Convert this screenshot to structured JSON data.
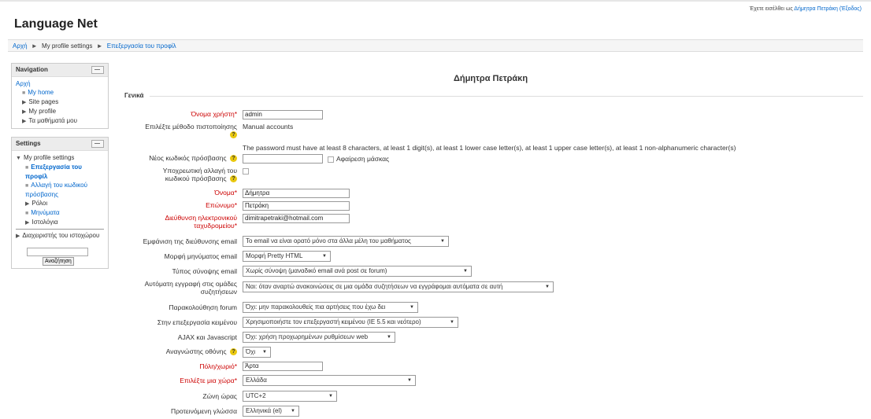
{
  "header": {
    "site_name": "Language Net",
    "login_prefix": "Έχετε εισέλθει ως",
    "login_user": "Δήμητρα Πετράκη",
    "logout": "(Έξοδος)"
  },
  "breadcrumb": {
    "home": "Αρχή",
    "sep": "►",
    "settings": "My profile settings",
    "current": "Επεξεργασία του προφίλ"
  },
  "navigation": {
    "title": "Navigation",
    "home": "Αρχή",
    "items": [
      "My home",
      "Site pages",
      "My profile",
      "Τα μαθήματά μου"
    ]
  },
  "settings": {
    "title": "Settings",
    "profile_settings": "My profile settings",
    "edit_profile": "Επεξεργασία του προφίλ",
    "change_password": "Αλλαγή του κωδικού πρόσβασης",
    "roles": "Ρόλοι",
    "messages": "Μηνύματα",
    "blogs": "Ιστολόγια",
    "site_admin": "Διαχειριστής του ιστοχώρου",
    "search_button": "Αναζήτηση"
  },
  "form": {
    "page_title": "Δήμητρα Πετράκη",
    "legend": "Γενικά",
    "username_label": "Όνομα χρήστη",
    "username": "admin",
    "auth_label": "Επιλέξτε μέθοδο πιστοποίησης",
    "auth_value": "Manual accounts",
    "password_rules": "The password must have at least 8 characters, at least 1 digit(s), at least 1 lower case letter(s), at least 1 upper case letter(s), at least 1 non-alphanumeric character(s)",
    "new_password_label": "Νέος κωδικός πρόσβασης",
    "unmask_label": "Αφαίρεση μάσκας",
    "force_change_label_1": "Υποχρεωτική αλλαγή του",
    "force_change_label_2": "κωδικού πρόσβασης",
    "firstname_label": "Όνομα",
    "firstname": "Δήμητρα",
    "lastname_label": "Επώνυμο",
    "lastname": "Πετράκη",
    "email_label_1": "Διεύθυνση ηλεκτρονικού",
    "email_label_2": "ταχυδρομείου",
    "email": "dimitrapetraki@hotmail.com",
    "emaildisplay_label": "Εμφάνιση της διεύθυνσης email",
    "emaildisplay": "Το email να είναι ορατό μόνο στα άλλα μέλη του μαθήματος",
    "mailformat_label": "Μορφή μηνύματος email",
    "mailformat": "Μορφή Pretty HTML",
    "maildigest_label": "Τύπος σύνοψης email",
    "maildigest": "Χωρίς σύνοψη (μαναδικό email ανά post σε forum)",
    "autosub_label_1": "Αυτόματη εγγραφή στις ομάδες",
    "autosub_label_2": "συζητήσεων",
    "autosub": "Ναι: όταν αναρτώ ανακοινώσεις σε μια ομάδα συζητήσεων να εγγράφομαι αυτόματα σε αυτή",
    "tracking_label": "Παρακολούθηση forum",
    "tracking": "Όχι: μην παρακολουθείς πια αρτήσεις που έχω δει",
    "editor_label": "Στην επεξεργασία κειμένου",
    "editor": "Χρησιμοποιήστε τον επεξεργαστή κειμένου (IE 5.5 και νεότερο)",
    "ajax_label": "AJAX και Javascript",
    "ajax": "Όχι: χρήση προχωρημένων ρυθμίσεων web",
    "screenreader_label": "Αναγνώστης οθόνης",
    "screenreader": "Όχι",
    "city_label": "Πόλη/χωριό",
    "city": "Άρτα",
    "country_label": "Επιλέξτε μια χώρα",
    "country": "Ελλάδα",
    "timezone_label": "Ζώνη ώρας",
    "timezone": "UTC+2",
    "lang_label": "Προτεινόμενη γλώσσα",
    "lang": "Ελληνικά (el)",
    "required_mark": "*",
    "help_mark": "?",
    "dropdown_arrow": "▼"
  }
}
